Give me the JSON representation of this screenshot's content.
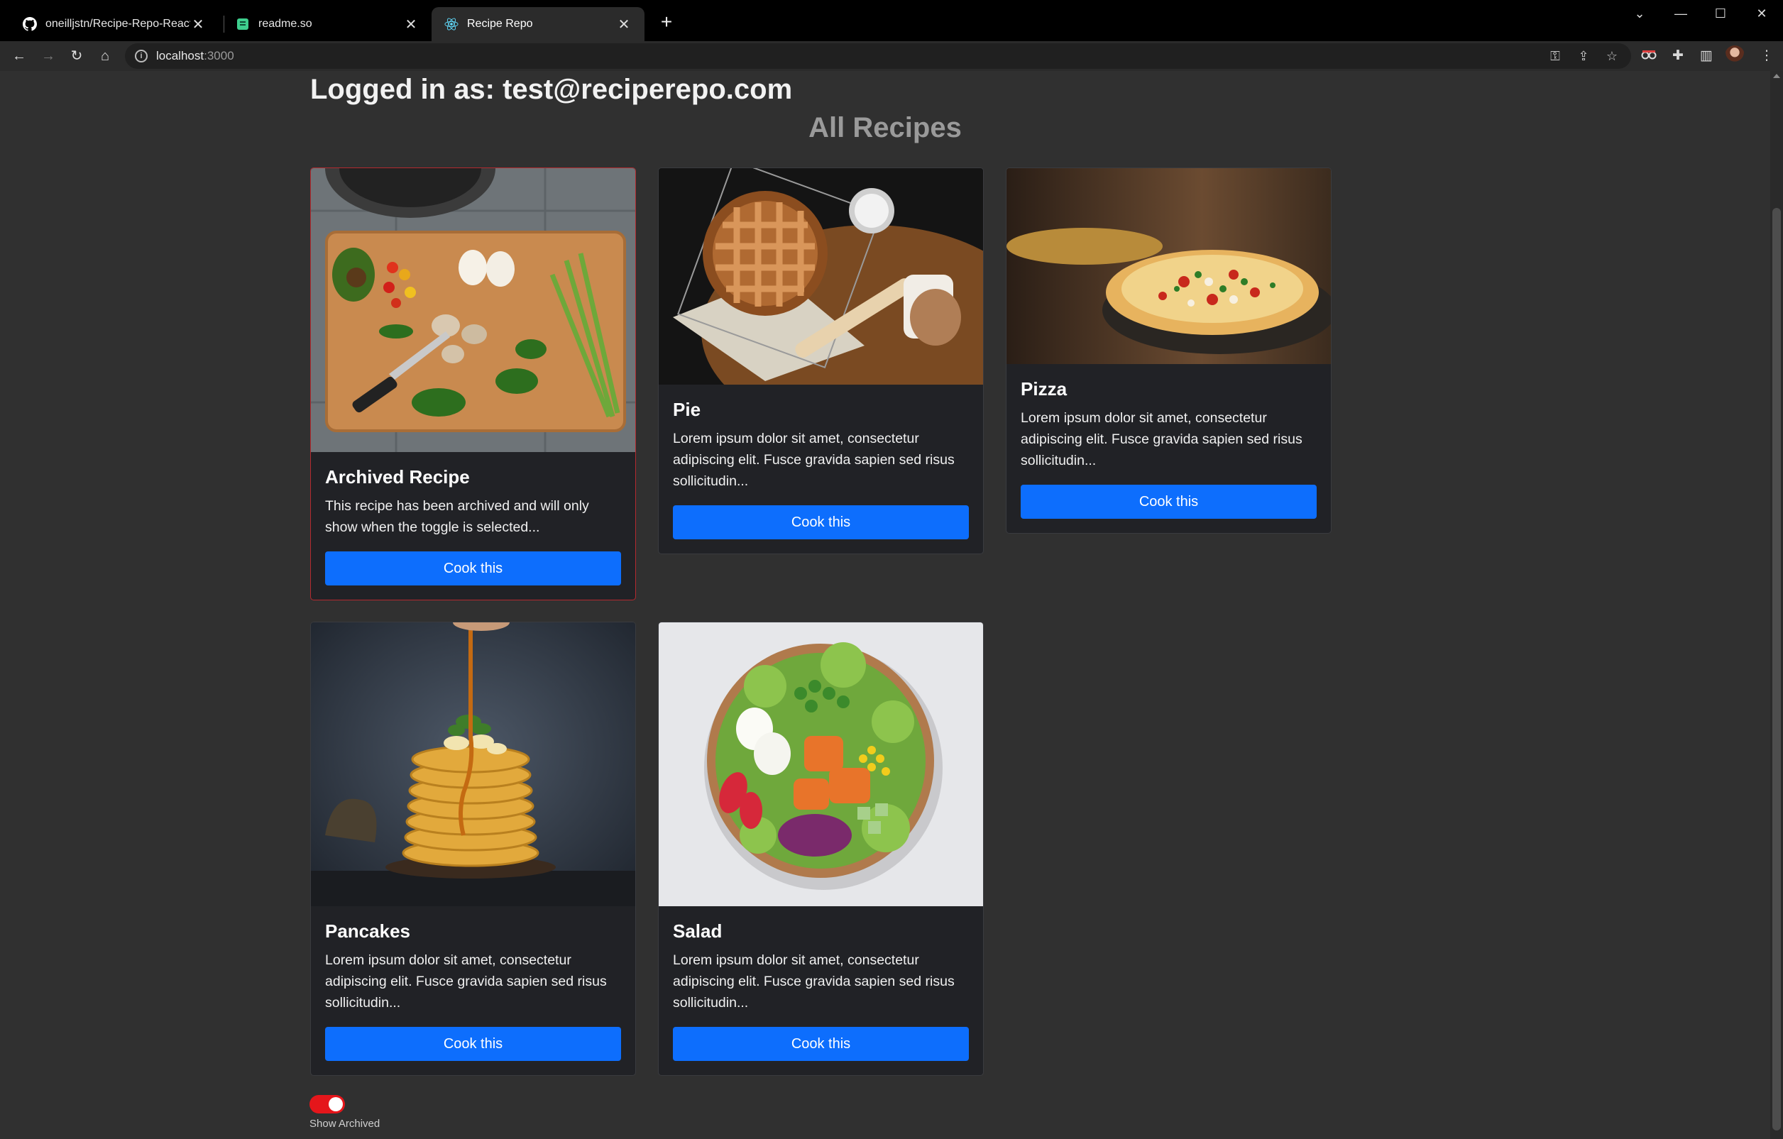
{
  "browser": {
    "tabs": [
      {
        "title": "oneilljstn/Recipe-Repo-React",
        "favicon": "github-icon"
      },
      {
        "title": "readme.so",
        "favicon": "readme-icon"
      },
      {
        "title": "Recipe Repo",
        "favicon": "react-icon",
        "active": true
      }
    ],
    "address": {
      "host": "localhost",
      "port": ":3000"
    }
  },
  "page": {
    "logged_in": "Logged in as: test@reciperepo.com",
    "section_title": "All Recipes",
    "recipes": [
      {
        "title": "Archived Recipe",
        "description": "This recipe has been archived and will only show when the toggle is selected...",
        "button": "Cook this",
        "archived": true,
        "image": "cutting-board-vegetables"
      },
      {
        "title": "Pie",
        "description": "Lorem ipsum dolor sit amet, consectetur adipiscing elit. Fusce gravida sapien sed risus sollicitudin...",
        "button": "Cook this",
        "image": "lattice-pie"
      },
      {
        "title": "Pizza",
        "description": "Lorem ipsum dolor sit amet, consectetur adipiscing elit. Fusce gravida sapien sed risus sollicitudin...",
        "button": "Cook this",
        "image": "pizza"
      },
      {
        "title": "Pancakes",
        "description": "Lorem ipsum dolor sit amet, consectetur adipiscing elit. Fusce gravida sapien sed risus sollicitudin...",
        "button": "Cook this",
        "image": "pancake-stack"
      },
      {
        "title": "Salad",
        "description": "Lorem ipsum dolor sit amet, consectetur adipiscing elit. Fusce gravida sapien sed risus sollicitudin...",
        "button": "Cook this",
        "image": "salad-bowl"
      }
    ],
    "toggle": {
      "label": "Show Archived",
      "on": true
    }
  },
  "colors": {
    "accent": "#0d6efd",
    "toggle_on": "#e5161b",
    "archived_border": "#b32a2f",
    "card_bg": "#212226",
    "page_bg": "#303030"
  }
}
